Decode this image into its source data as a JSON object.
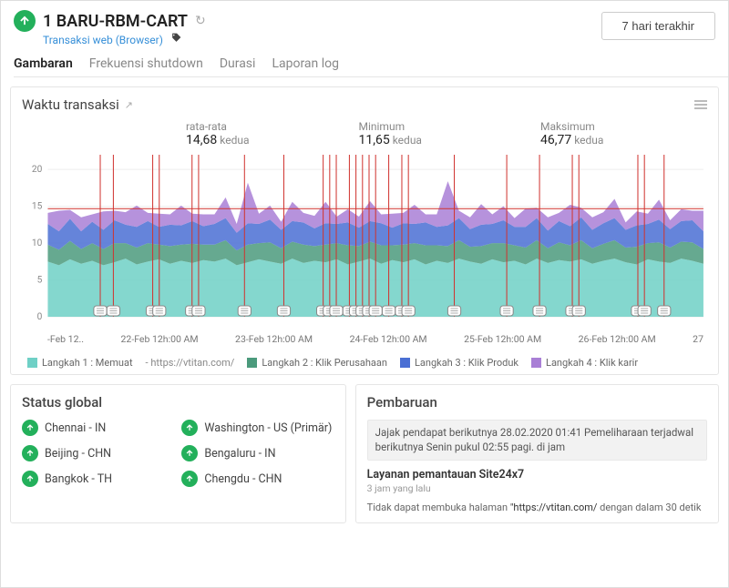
{
  "header": {
    "title": "1 BARU-RBM-CART",
    "subtitle": "Transaksi web (Browser)",
    "time_range": "7 hari terakhir"
  },
  "tabs": [
    "Gambaran",
    "Frekuensi shutdown",
    "Durasi",
    "Laporan log"
  ],
  "active_tab": 0,
  "transaction_panel": {
    "title": "Waktu transaksi",
    "stats": {
      "avg_label": "rata-rata",
      "avg_value": "14,68",
      "min_label": "Minimum",
      "min_value": "11,65",
      "max_label": "Maksimum",
      "max_value": "46,77",
      "unit": "kedua"
    }
  },
  "chart_data": {
    "type": "area",
    "ylim": [
      0,
      22
    ],
    "yticks": [
      0,
      5,
      10,
      15,
      20
    ],
    "threshold": 14.68,
    "xticks": [
      "-Feb 12..",
      "22-Feb 12h:00 AM",
      "23-Feb 12h:00 AM",
      "24-Feb 12h:00 AM",
      "25-Feb 12h:00 AM",
      "26-Feb 12h:00 AM",
      "27"
    ],
    "series": [
      {
        "name": "Langkah 1 : Memuat",
        "url": "- https://vtitan.com/",
        "color": "#6fd0c6",
        "values": [
          7.5,
          7.0,
          7.8,
          7.2,
          7.6,
          7.0,
          7.4,
          7.9,
          7.1,
          7.5,
          7.8,
          7.2,
          7.6,
          7.3,
          7.7,
          7.5,
          7.9,
          7.0,
          7.4,
          7.8,
          7.5,
          7.2,
          7.9,
          7.3,
          7.6,
          7.4,
          7.8,
          7.1,
          7.5,
          7.9,
          7.2,
          7.7,
          7.4,
          7.8,
          7.1,
          7.6,
          7.3,
          7.9,
          7.5,
          7.2,
          7.8,
          7.4,
          7.6,
          7.1,
          7.9,
          7.3,
          7.7,
          7.5,
          7.8,
          7.2,
          7.6,
          7.9,
          7.4,
          7.1,
          7.8,
          7.5,
          7.3,
          7.9,
          7.6,
          7.2
        ]
      },
      {
        "name": "Langkah 2 : Klik Perusahaan",
        "color": "#4b9a7c",
        "values": [
          2.3,
          2.1,
          2.5,
          2.0,
          2.4,
          2.2,
          2.6,
          2.1,
          2.3,
          2.5,
          2.0,
          2.4,
          2.2,
          2.6,
          2.1,
          2.3,
          2.5,
          2.0,
          2.4,
          2.2,
          2.6,
          2.1,
          2.3,
          2.5,
          2.0,
          2.4,
          2.2,
          2.6,
          2.1,
          2.3,
          2.5,
          2.0,
          2.4,
          2.2,
          2.6,
          2.1,
          2.3,
          2.5,
          2.0,
          2.4,
          2.2,
          2.6,
          2.1,
          2.3,
          2.5,
          2.0,
          2.4,
          2.2,
          2.6,
          2.1,
          2.3,
          2.5,
          2.0,
          2.4,
          2.2,
          2.6,
          2.1,
          2.3,
          2.5,
          2.0
        ]
      },
      {
        "name": "Langkah 3 : Klik Produk",
        "color": "#4a6fd4",
        "values": [
          2.8,
          2.5,
          3.0,
          2.4,
          2.9,
          2.6,
          3.1,
          2.5,
          2.8,
          3.0,
          2.4,
          2.9,
          2.6,
          3.1,
          2.5,
          2.8,
          3.0,
          2.4,
          2.9,
          2.6,
          3.1,
          2.5,
          2.8,
          3.0,
          2.4,
          2.9,
          2.6,
          3.1,
          2.5,
          2.8,
          3.0,
          2.4,
          2.9,
          2.6,
          3.1,
          2.5,
          2.8,
          3.0,
          2.4,
          2.9,
          2.6,
          3.1,
          2.5,
          2.8,
          3.0,
          2.4,
          2.9,
          2.6,
          3.1,
          2.5,
          2.8,
          3.0,
          2.4,
          2.9,
          2.6,
          3.1,
          2.5,
          2.8,
          3.0,
          2.4
        ]
      },
      {
        "name": "Langkah 4 : Klik karir",
        "color": "#a97fd6",
        "values": [
          1.5,
          2.8,
          1.2,
          1.9,
          1.0,
          2.5,
          1.3,
          1.7,
          2.9,
          1.1,
          1.8,
          1.4,
          2.7,
          1.0,
          1.6,
          1.3,
          2.8,
          1.2,
          5.5,
          1.4,
          1.9,
          1.1,
          2.6,
          1.3,
          1.7,
          2.9,
          1.0,
          1.8,
          1.5,
          2.7,
          1.2,
          1.9,
          1.4,
          2.6,
          1.1,
          1.7,
          6.0,
          1.0,
          1.6,
          2.8,
          1.3,
          1.9,
          1.2,
          2.5,
          1.4,
          1.8,
          1.1,
          2.9,
          1.3,
          1.7,
          1.5,
          2.6,
          1.0,
          1.9,
          1.4,
          2.7,
          1.2,
          1.6,
          1.3,
          2.8
        ]
      }
    ],
    "event_markers": [
      0.08,
      0.1,
      0.16,
      0.17,
      0.22,
      0.23,
      0.3,
      0.36,
      0.42,
      0.43,
      0.44,
      0.46,
      0.47,
      0.48,
      0.49,
      0.5,
      0.52,
      0.54,
      0.55,
      0.62,
      0.7,
      0.75,
      0.8,
      0.81,
      0.9,
      0.91,
      0.94
    ]
  },
  "global_status": {
    "title": "Status global",
    "locations": [
      {
        "name": "Chennai - IN"
      },
      {
        "name": "Washington - US (Primär)"
      },
      {
        "name": "Beijing - CHN"
      },
      {
        "name": "Bengaluru - IN"
      },
      {
        "name": "Bangkok - TH"
      },
      {
        "name": "Chengdu - CHN"
      }
    ]
  },
  "updates": {
    "title": "Pembaruan",
    "highlight": "Jajak pendapat berikutnya 28.02.2020 01:41 Pemeliharaan terjadwal berikutnya Senin pukul 02:55 pagi. di jam",
    "service_title": "Layanan pemantauan Site24x7",
    "service_time": "3 jam yang lalu",
    "error_prefix": "Tidak dapat membuka halaman",
    "error_url": "\"https://vtitan.com/",
    "error_suffix": "dengan dalam 30 detik"
  }
}
